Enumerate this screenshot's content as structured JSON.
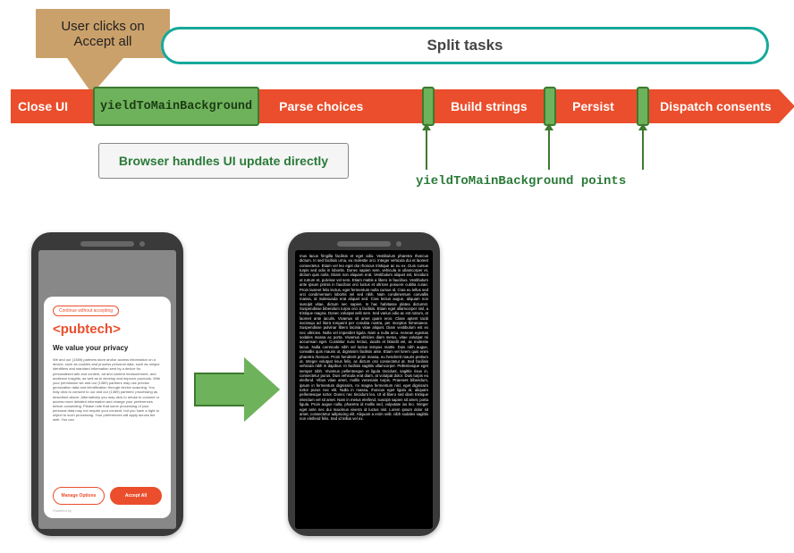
{
  "callout": "User clicks on Accept all",
  "split_label": "Split tasks",
  "timeline": {
    "close_ui": "Close UI",
    "ytm_box": "yieldToMainBackground",
    "parse": "Parse choices",
    "build": "Build strings",
    "persist": "Persist",
    "dispatch": "Dispatch consents"
  },
  "browser_box": "Browser handles UI update directly",
  "ytm_points": "yieldToMainBackground points",
  "phone_consent": {
    "pill": "Continue without accepting",
    "logo": "<pubtech>",
    "title": "We value your privacy",
    "body": "We and our (1389) partners store and/or access information on a device, such as cookies and process personal data, such as unique identifiers and standard information sent by a device for personalised ads and content, ad and content measurement, and audience insights, as well as to develop and improve products. With your permission we and our (1389) partners may use precise geolocation data and identification through device scanning. You may click to consent to our and our (1389) partners' processing as described above. Alternatively you may click to refuse to consent or access more detailed information and change your preferences before consenting. Please note that some processing of your personal data may not require your consent, but you have a right to object to such processing. Your preferences will apply across the web. You can",
    "manage": "Manage Options",
    "accept": "Accept All",
    "powered": "Powered by"
  },
  "phone_text": "mus lacus fringilla facilisis et eget odio. Vestibulum pharetra rhoncus dictum. In sed facilisis urna, eu molestie orci. Integer vehicula dui et laoreet consectetur. Etiam vel leo eget dui rhoncus tristique ac eu ex. Duis cursus turpis sed odio in lobortis. Donec sapien sem, vehicula in ullamcorper et, dictum quis nulla. Etiam non aliquam erat. Vestibulum aliquet est, tincidunt ut rutrum et, pulvinar vel sem. Etiam mattis a libero in faucibus. Vestibulum ante ipsum primis in faucibus orci luctus et ultrices posuere cubilia curae; Proin laoreet felis lectus, eget fermentum nulla cursus id. Cras eu tellus sed orci condimentum lobortis vel sed nibh. Nam condimentum convallis massa, id malesuada erat aliquet sed. Cras lectus augue, aliquam non suscipit vitae, dictum nec sapien. In hac habitasse platea dictumst. Suspendisse bibendum turpis orci a facilisis. Etiam eget ullamcorper nisl, a tristique magna. Donec volutpat velit sem. Sed varius odio ac est rutrum, at laoreet ante iaculis. Vivamus sit amet quam eros. Class aptent taciti sociosqu ad litora torquent per conubia nostra, per inceptos himenaeos. Suspendisse pulvinar libero lacinia vitae aliquet. Diam vestibulum est ex nec ultricies. Nulla vel imperdiet ligula. Nam a nulla arcu. Aenean egestas sodales massa ac porta. Vivamus ultricies diam metus, vitae volutpat mi accumsan eget. Curabitur nunc lectus, iaculis et blandit vel, ac molestie lacus. Nulla commodo nibh vel luctus tempus mattis. Duis nibh augue, convallis quis mauris ut, dignissim facilisis ante. Etiam vel lorem quis enim pharetra rhoncus. Proin hendrerit proin massa, eu hendrerit mauris pretium ut. Integer volutpat risus felis, ac dictum orci consectetur at. Sed facilisis vehicula nibh in dapibus. In facilisis sagittis ullamcorper. Pellentesque eget semper nibh. Vivamus pellentesque et ligula tincidunt, sagittis risus in, consectetur purus. Duis vehicula erat diam, at volutpat dolor. Duis turpis eu eleifend. Vibus vitae amet, mollis venenatis turpis. Praesent bibendum, ipsum in fermentum dignissim, mi magna fermentum nisl, eget dignissim tortor purus nec elit. Nulla in massa, rhoncus eget ligula at, aliquam pellentesque tortor. Donec nec tincidunt leo. Ut id libero sed diam tristique interdum vel sit amet. Nam in metus eleifend, suscipit sapien sit amet, porta ligula. Proin augue nulla, pharetra id mollis sed, vulputate ius leo. Integer eget ante nec dui maximus viverra id luctus nisl. Lorem ipsum dolor sit amet, consectetur adipiscing elit. Aliquam a enim velit. nibh sodales sagittis non eleifend felis. Sed id tellus vel ex.",
  "colors": {
    "orange": "#ea4e2c",
    "green": "#6eb35b",
    "green_dark": "#3d7a2f",
    "teal": "#16a99b",
    "tan": "#cba16b"
  }
}
